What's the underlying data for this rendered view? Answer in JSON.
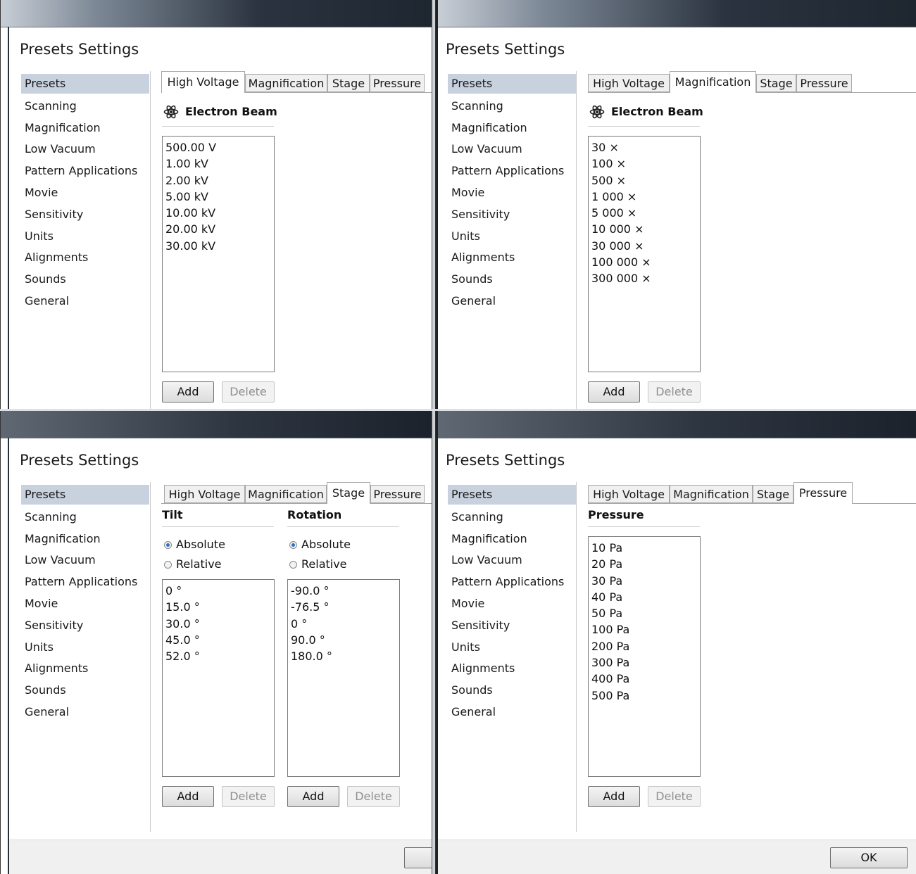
{
  "dialog_title": "Presets Settings",
  "sidebar_items": [
    "Presets",
    "Scanning",
    "Magnification",
    "Low Vacuum",
    "Pattern Applications",
    "Movie",
    "Sensitivity",
    "Units",
    "Alignments",
    "Sounds",
    "General"
  ],
  "tabs": [
    "High Voltage",
    "Magnification",
    "Stage",
    "Pressure"
  ],
  "beam_heading": "Electron Beam",
  "voltage_presets": [
    "500.00 V",
    "1.00 kV",
    "2.00 kV",
    "5.00 kV",
    "10.00 kV",
    "20.00 kV",
    "30.00 kV"
  ],
  "magnification_presets": [
    "30 ×",
    "100 ×",
    "500 ×",
    "1 000 ×",
    "5 000 ×",
    "10 000 ×",
    "30 000 ×",
    "100 000 ×",
    "300 000 ×"
  ],
  "stage": {
    "tilt_heading": "Tilt",
    "rotation_heading": "Rotation",
    "absolute_label": "Absolute",
    "relative_label": "Relative",
    "tilt_presets": [
      "0 °",
      "15.0 °",
      "30.0 °",
      "45.0 °",
      "52.0 °"
    ],
    "rotation_presets": [
      "-90.0 °",
      "-76.5 °",
      "0 °",
      "90.0 °",
      "180.0 °"
    ]
  },
  "pressure_heading": "Pressure",
  "pressure_presets": [
    "10 Pa",
    "20 Pa",
    "30 Pa",
    "40 Pa",
    "50 Pa",
    "100 Pa",
    "200 Pa",
    "300 Pa",
    "400 Pa",
    "500 Pa"
  ],
  "buttons": {
    "add": "Add",
    "delete": "Delete",
    "ok": "OK"
  },
  "selected_mode": "Absolute"
}
